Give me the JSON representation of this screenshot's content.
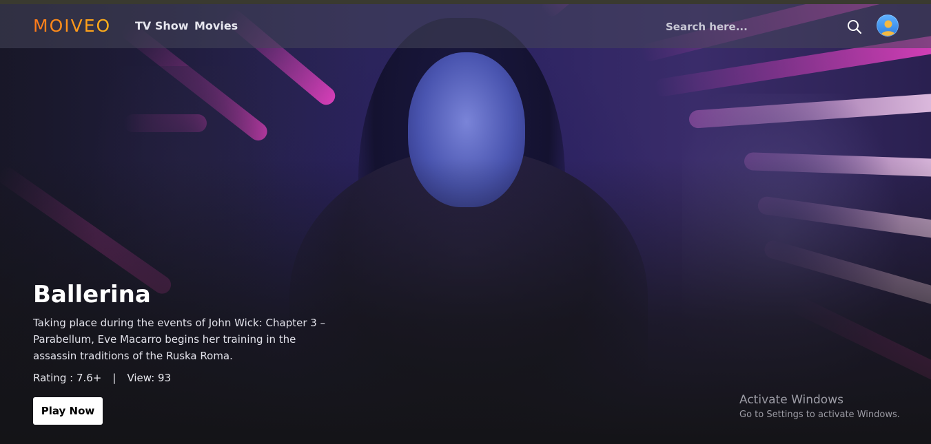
{
  "brand": {
    "logo_text": "MOIVEO",
    "accent_gradient": [
      "#ff7a1a",
      "#ffb21a"
    ]
  },
  "nav": {
    "links": [
      {
        "label": "TV Show"
      },
      {
        "label": "Movies"
      }
    ],
    "search": {
      "placeholder": "Search here...",
      "value": "",
      "icon": "search-icon"
    },
    "user": {
      "icon": "user-avatar-icon"
    }
  },
  "hero": {
    "title": "Ballerina",
    "description": "Taking place during the events of John Wick: Chapter 3 – Parabellum, Eve Macarro begins her training in the assassin traditions of the Ruska Roma.",
    "rating_label": "Rating : 7.6+",
    "separator": "|",
    "views_label": "View: 93",
    "play_button": "Play Now"
  },
  "os_watermark": {
    "title": "Activate Windows",
    "subtitle": "Go to Settings to activate Windows."
  }
}
